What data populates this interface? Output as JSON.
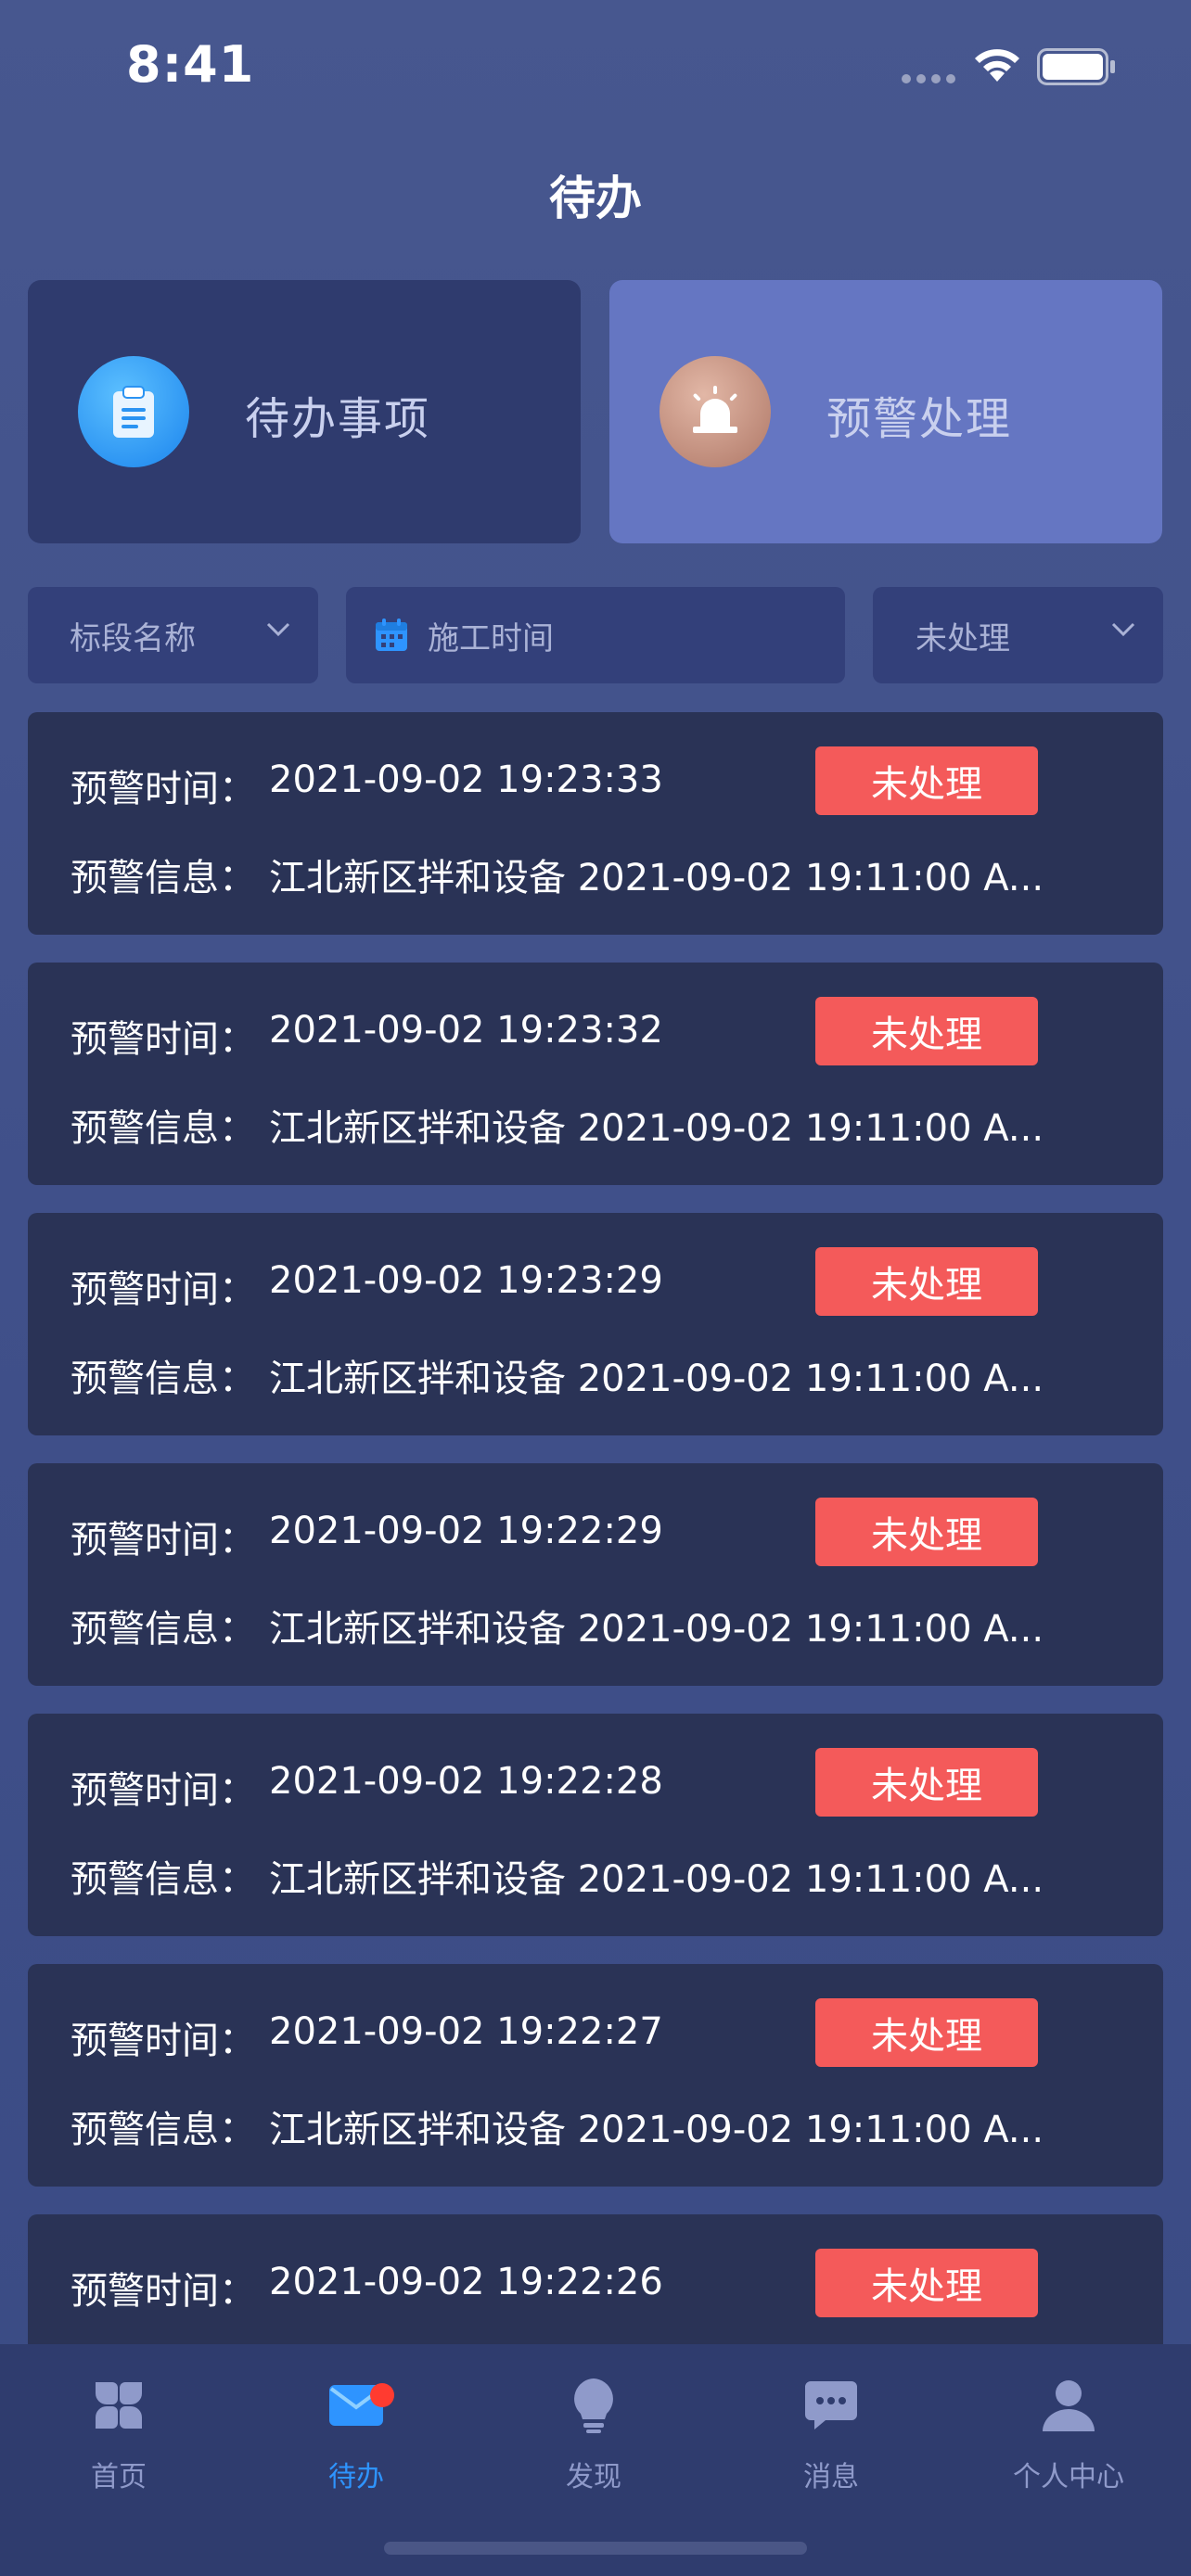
{
  "status_bar": {
    "time": "8:41"
  },
  "header": {
    "title": "待办"
  },
  "top_cards": [
    {
      "label": "待办事项",
      "icon": "clipboard-icon",
      "color": "#2b93f2"
    },
    {
      "label": "预警处理",
      "icon": "alarm-siren-icon",
      "color": "#b98473"
    }
  ],
  "filters": {
    "section": "标段名称",
    "time": "施工时间",
    "status": "未处理"
  },
  "labels": {
    "time_label": "预警时间：",
    "info_label": "预警信息："
  },
  "warnings": [
    {
      "time": "2021-09-02 19:23:33",
      "info": "江北新区拌和设备 2021-09-02 19:11:00 A...",
      "status": "未处理"
    },
    {
      "time": "2021-09-02 19:23:32",
      "info": "江北新区拌和设备 2021-09-02 19:11:00 A...",
      "status": "未处理"
    },
    {
      "time": "2021-09-02 19:23:29",
      "info": "江北新区拌和设备 2021-09-02 19:11:00 A...",
      "status": "未处理"
    },
    {
      "time": "2021-09-02 19:22:29",
      "info": "江北新区拌和设备 2021-09-02 19:11:00 A...",
      "status": "未处理"
    },
    {
      "time": "2021-09-02 19:22:28",
      "info": "江北新区拌和设备 2021-09-02 19:11:00 A...",
      "status": "未处理"
    },
    {
      "time": "2021-09-02 19:22:27",
      "info": "江北新区拌和设备 2021-09-02 19:11:00 A...",
      "status": "未处理"
    },
    {
      "time": "2021-09-02 19:22:26",
      "info": "",
      "status": "未处理"
    }
  ],
  "tabs": [
    {
      "label": "首页",
      "icon": "grid-petals-icon"
    },
    {
      "label": "待办",
      "icon": "mail-icon",
      "active": true
    },
    {
      "label": "发现",
      "icon": "lightbulb-icon"
    },
    {
      "label": "消息",
      "icon": "chat-bubble-icon"
    },
    {
      "label": "个人中心",
      "icon": "person-icon"
    }
  ],
  "colors": {
    "accent": "#2e94ff",
    "status_red": "#f45a5a",
    "card_bg": "#2a3356",
    "alert_card_bg": "#6576c2"
  }
}
